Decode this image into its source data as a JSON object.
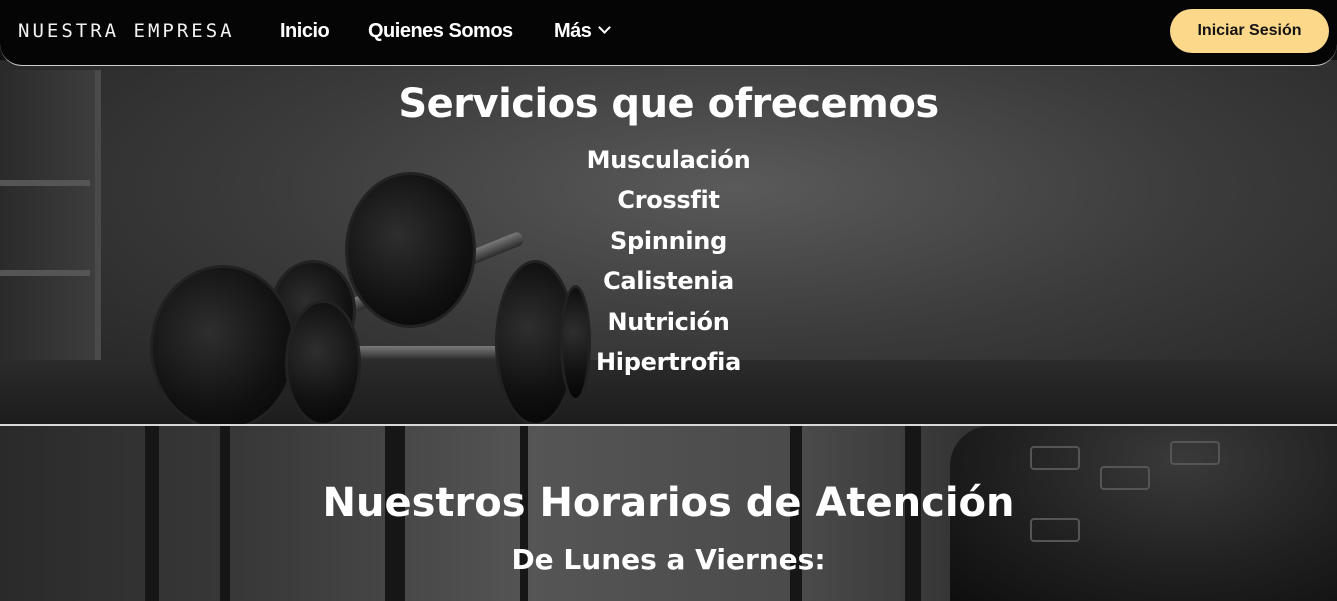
{
  "nav": {
    "brand": "NUESTRA EMPRESA",
    "links": [
      "Inicio",
      "Quienes Somos",
      "Más"
    ],
    "login_label": "Iniciar Sesión",
    "login_color": "#fcd88a"
  },
  "services": {
    "title": "Servicios que ofrecemos",
    "items": [
      "Musculación",
      "Crossfit",
      "Spinning",
      "Calistenia",
      "Nutrición",
      "Hipertrofia"
    ]
  },
  "hours": {
    "title": "Nuestros Horarios de Atención",
    "subtitle": "De Lunes a Viernes:"
  }
}
